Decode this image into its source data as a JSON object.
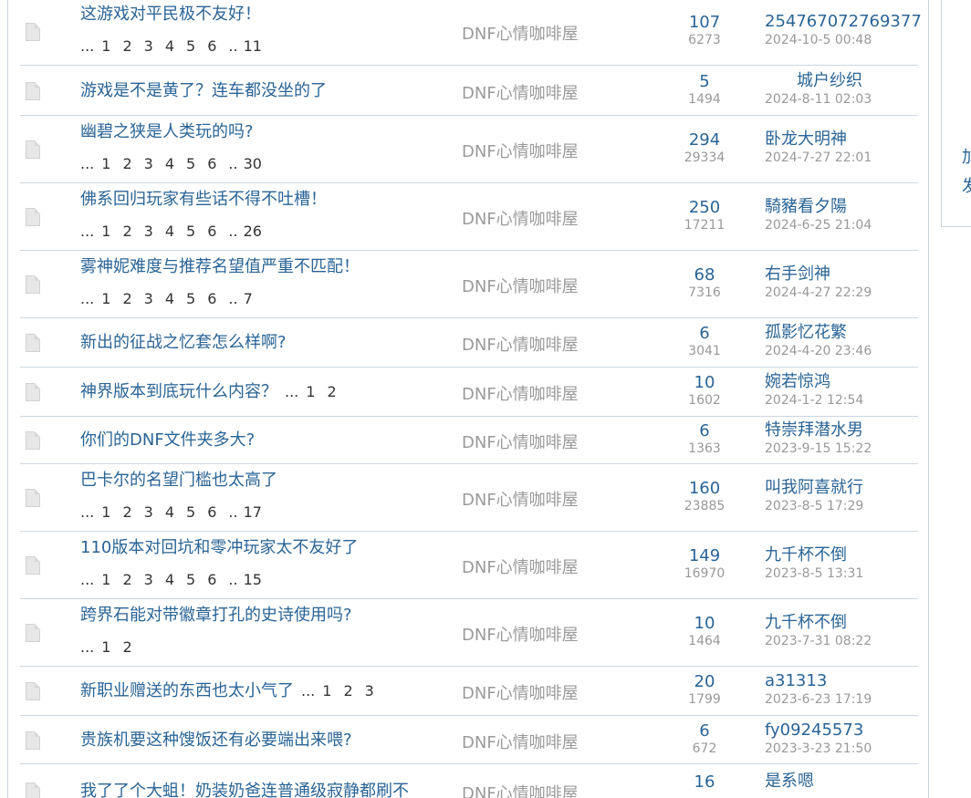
{
  "topics": [
    {
      "title": "这游戏对平民极不友好！",
      "pages": [
        "1",
        "2",
        "3",
        "4",
        "5",
        "6"
      ],
      "last_page": "11",
      "forum": "DNF心情咖啡屋",
      "replies": "107",
      "views": "6273",
      "last_user": "254767072769377",
      "last_time": "2024-10-5 00:48"
    },
    {
      "title": "游戏是不是黄了？连车都没坐的了",
      "pages": [],
      "last_page": "",
      "forum": "DNF心情咖啡屋",
      "replies": "5",
      "views": "1494",
      "last_user": "城户纱织",
      "last_time": "2024-8-11 02:03"
    },
    {
      "title": "幽碧之狭是人类玩的吗?",
      "pages": [
        "1",
        "2",
        "3",
        "4",
        "5",
        "6"
      ],
      "last_page": "30",
      "forum": "DNF心情咖啡屋",
      "replies": "294",
      "views": "29334",
      "last_user": "卧龙大明神",
      "last_time": "2024-7-27 22:01"
    },
    {
      "title": "佛系回归玩家有些话不得不吐槽！",
      "pages": [
        "1",
        "2",
        "3",
        "4",
        "5",
        "6"
      ],
      "last_page": "26",
      "forum": "DNF心情咖啡屋",
      "replies": "250",
      "views": "17211",
      "last_user": "騎豬看夕陽",
      "last_time": "2024-6-25 21:04"
    },
    {
      "title": "雾神妮难度与推荐名望值严重不匹配！",
      "pages": [
        "1",
        "2",
        "3",
        "4",
        "5",
        "6"
      ],
      "last_page": "7",
      "forum": "DNF心情咖啡屋",
      "replies": "68",
      "views": "7316",
      "last_user": "右手剑神",
      "last_time": "2024-4-27 22:29"
    },
    {
      "title": "新出的征战之忆套怎么样啊?",
      "pages": [],
      "last_page": "",
      "forum": "DNF心情咖啡屋",
      "replies": "6",
      "views": "3041",
      "last_user": "孤影忆花繁",
      "last_time": "2024-4-20 23:46"
    },
    {
      "title": "神界版本到底玩什么内容？",
      "inline_pages": [
        "1",
        "2"
      ],
      "pages": [],
      "last_page": "",
      "forum": "DNF心情咖啡屋",
      "replies": "10",
      "views": "1602",
      "last_user": "婉若惊鸿",
      "last_time": "2024-1-2 12:54"
    },
    {
      "title": "你们的DNF文件夹多大?",
      "pages": [],
      "last_page": "",
      "forum": "DNF心情咖啡屋",
      "replies": "6",
      "views": "1363",
      "last_user": "特崇拜潜水男",
      "last_time": "2023-9-15 15:22"
    },
    {
      "title": "巴卡尔的名望门槛也太高了",
      "pages": [
        "1",
        "2",
        "3",
        "4",
        "5",
        "6"
      ],
      "last_page": "17",
      "forum": "DNF心情咖啡屋",
      "replies": "160",
      "views": "23885",
      "last_user": "叫我阿喜就行",
      "last_time": "2023-8-5 17:29"
    },
    {
      "title": "110版本对回坑和零冲玩家太不友好了",
      "pages": [
        "1",
        "2",
        "3",
        "4",
        "5",
        "6"
      ],
      "last_page": "15",
      "forum": "DNF心情咖啡屋",
      "replies": "149",
      "views": "16970",
      "last_user": "九千杯不倒",
      "last_time": "2023-8-5 13:31"
    },
    {
      "title": "跨界石能对带徽章打孔的史诗使用吗?",
      "pages": [
        "1",
        "2"
      ],
      "last_page": "",
      "forum": "DNF心情咖啡屋",
      "replies": "10",
      "views": "1464",
      "last_user": "九千杯不倒",
      "last_time": "2023-7-31 08:22"
    },
    {
      "title": "新职业赠送的东西也太小气了",
      "inline_pages": [
        "1",
        "2",
        "3"
      ],
      "pages": [],
      "last_page": "",
      "forum": "DNF心情咖啡屋",
      "replies": "20",
      "views": "1799",
      "last_user": "a31313",
      "last_time": "2023-6-23 17:19"
    },
    {
      "title": "贵族机要这种馊饭还有必要端出来喂?",
      "pages": [],
      "last_page": "",
      "forum": "DNF心情咖啡屋",
      "replies": "6",
      "views": "672",
      "last_user": "fy09245573",
      "last_time": "2023-3-23 21:50"
    },
    {
      "title": "我了了个大蛆！奶装奶爸连普通级寂静都刷不",
      "pages": [],
      "last_page": "",
      "forum": "DNF心情咖啡屋",
      "replies": "16",
      "views": "",
      "last_user": "是系嗯",
      "last_time": ""
    }
  ],
  "pagination_ellipsis": "...",
  "pagination_dots": "..",
  "sidebar": {
    "line1": "加",
    "line2": "发"
  }
}
